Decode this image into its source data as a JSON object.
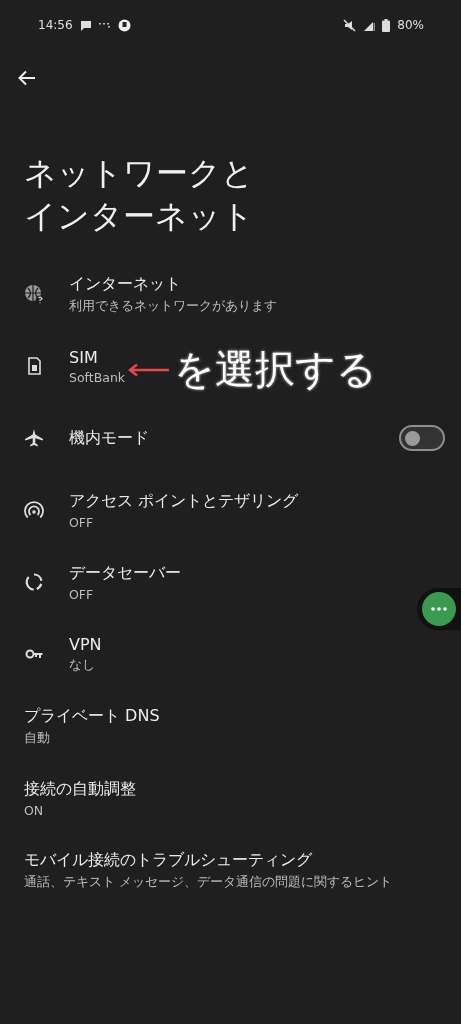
{
  "status_bar": {
    "time": "14:56",
    "battery": "80%"
  },
  "title_lines": [
    "ネットワークと",
    "インターネット"
  ],
  "items": [
    {
      "kind": "icon",
      "title": "インターネット",
      "summary": "利用できるネットワークがあります"
    },
    {
      "kind": "icon",
      "title": "SIM",
      "summary": "SoftBank",
      "annotation": "を選択する"
    },
    {
      "kind": "toggle",
      "title": "機内モード",
      "on": false
    },
    {
      "kind": "icon",
      "title": "アクセス ポイントとテザリング",
      "summary": "OFF"
    },
    {
      "kind": "icon",
      "title": "データセーバー",
      "summary": "OFF"
    },
    {
      "kind": "icon",
      "title": "VPN",
      "summary": "なし"
    },
    {
      "kind": "plain",
      "title": "プライベート DNS",
      "summary": "自動"
    },
    {
      "kind": "plain",
      "title": "接続の自動調整",
      "summary": "ON"
    },
    {
      "kind": "plain",
      "title": "モバイル接続のトラブルシューティング",
      "summary": "通話、テキスト メッセージ、データ通信の問題に関するヒント"
    }
  ]
}
